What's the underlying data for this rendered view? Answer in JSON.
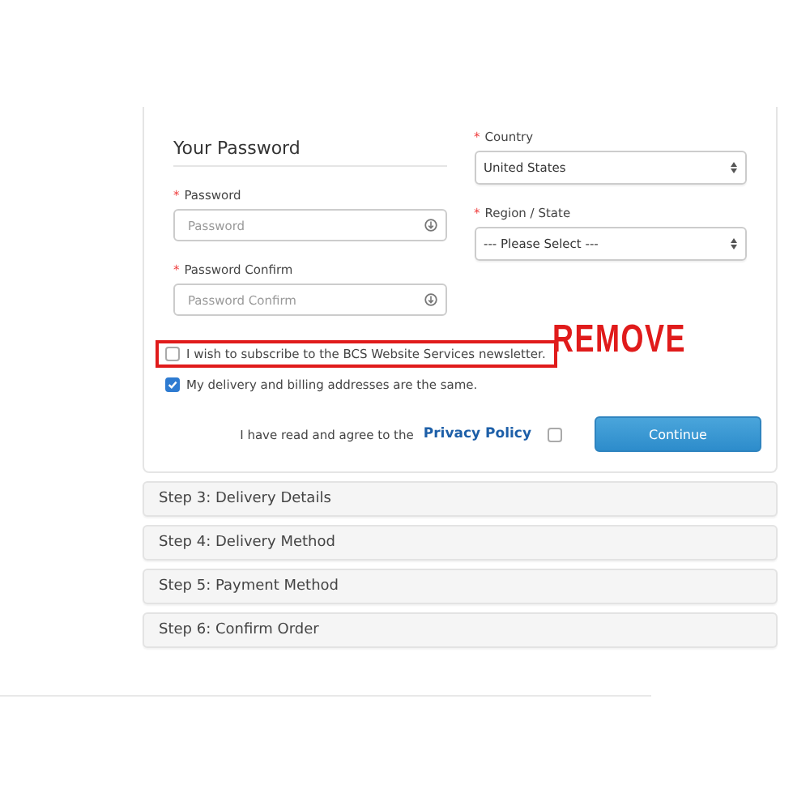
{
  "password_section": {
    "heading": "Your Password",
    "fields": [
      {
        "mark": "*",
        "label": "Password",
        "placeholder": "Password"
      },
      {
        "mark": "*",
        "label": "Password Confirm",
        "placeholder": "Password Confirm"
      }
    ]
  },
  "address_section": {
    "selects": [
      {
        "mark": "*",
        "label": "Country",
        "value": "United States"
      },
      {
        "mark": "*",
        "label": "Region / State",
        "value": "--- Please Select ---"
      }
    ]
  },
  "options": [
    {
      "label": "I wish to subscribe to the BCS Website Services newsletter.",
      "checked": false,
      "highlighted": true
    },
    {
      "label": "My delivery and billing addresses are the same.",
      "checked": true,
      "highlighted": false
    }
  ],
  "annotation": "REMOVE",
  "agreement": {
    "text": "I have read and agree to the",
    "link": "Privacy Policy",
    "checked": false
  },
  "continue_button": "Continue",
  "steps": [
    {
      "title": "Step 3: Delivery Details"
    },
    {
      "title": "Step 4: Delivery Method"
    },
    {
      "title": "Step 5: Payment Method"
    },
    {
      "title": "Step 6: Confirm Order"
    }
  ]
}
